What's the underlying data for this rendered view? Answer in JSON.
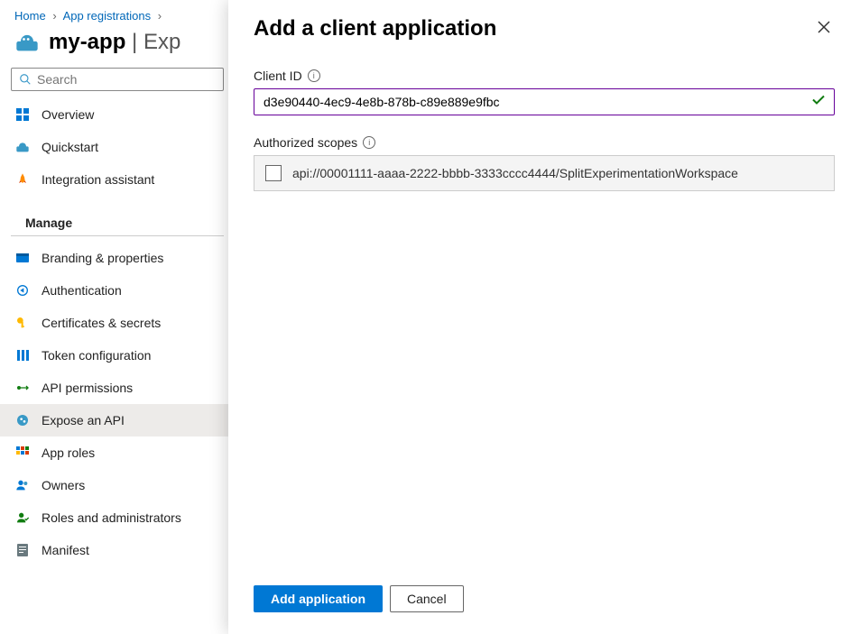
{
  "breadcrumb": {
    "home": "Home",
    "app_reg": "App registrations"
  },
  "page": {
    "app_name": "my-app",
    "sep": " | ",
    "section": "Exp"
  },
  "search": {
    "placeholder": "Search"
  },
  "nav": {
    "overview": "Overview",
    "quickstart": "Quickstart",
    "integration": "Integration assistant",
    "manage_header": "Manage",
    "branding": "Branding & properties",
    "authentication": "Authentication",
    "certificates": "Certificates & secrets",
    "token": "Token configuration",
    "api_permissions": "API permissions",
    "expose_api": "Expose an API",
    "app_roles": "App roles",
    "owners": "Owners",
    "roles_admin": "Roles and administrators",
    "manifest": "Manifest"
  },
  "panel": {
    "title": "Add a client application",
    "client_id_label": "Client ID",
    "client_id_value": "d3e90440-4ec9-4e8b-878b-c89e889e9fbc",
    "scopes_label": "Authorized scopes",
    "scope_value": "api://00001111-aaaa-2222-bbbb-3333cccc4444/SplitExperimentationWorkspace",
    "add_button": "Add application",
    "cancel_button": "Cancel"
  }
}
